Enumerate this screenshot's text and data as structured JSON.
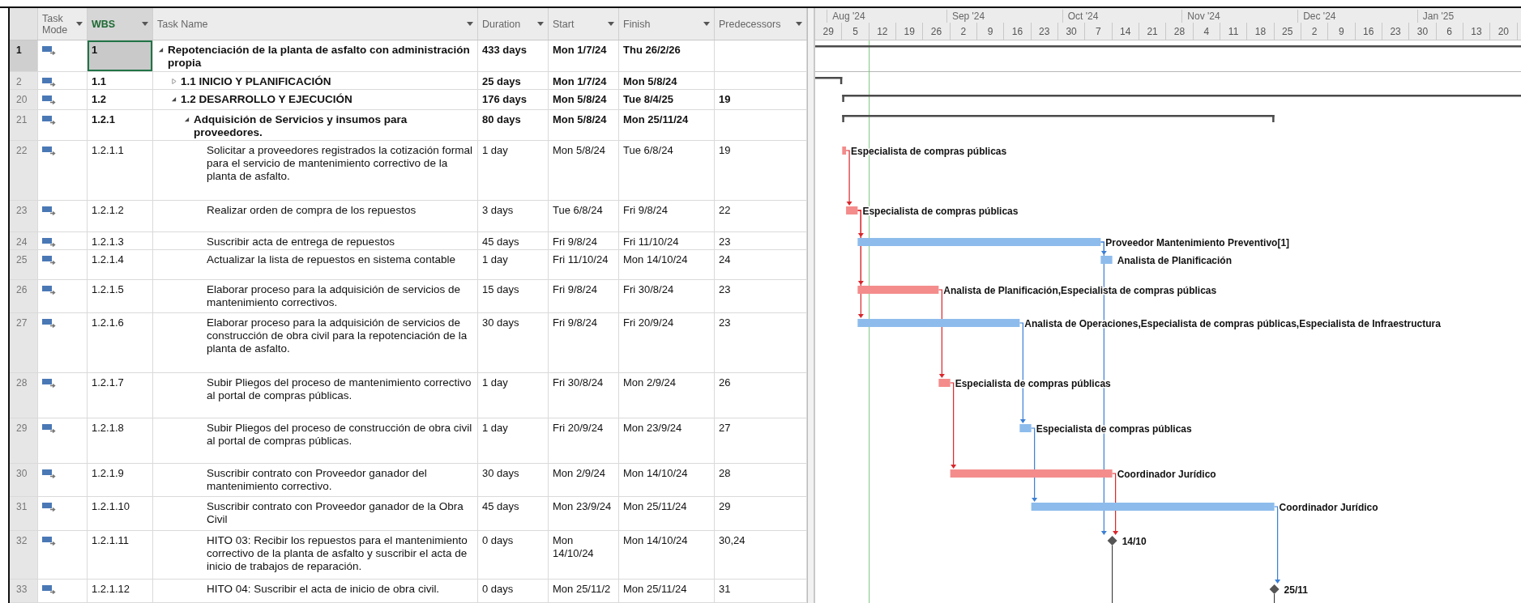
{
  "columns": [
    {
      "label": "Task Mode",
      "selected": false
    },
    {
      "label": "WBS",
      "selected": true
    },
    {
      "label": "Task Name",
      "selected": false
    },
    {
      "label": "Duration",
      "selected": false
    },
    {
      "label": "Start",
      "selected": false
    },
    {
      "label": "Finish",
      "selected": false
    },
    {
      "label": "Predecessors",
      "selected": false
    }
  ],
  "timescale": {
    "months": [
      "Aug '24",
      "Sep '24",
      "Oct '24",
      "Nov '24",
      "Dec '24",
      "Jan '25"
    ],
    "weeks": [
      "29",
      "5",
      "12",
      "19",
      "26",
      "2",
      "9",
      "16",
      "23",
      "30",
      "7",
      "14",
      "21",
      "28",
      "4",
      "11",
      "18",
      "25",
      "2",
      "9",
      "16",
      "23",
      "30",
      "6",
      "13",
      "20"
    ]
  },
  "tasks": [
    {
      "id": "1",
      "kind": "summary",
      "selected": true,
      "expanded": true,
      "wbs": "1",
      "name": "Repotenciación de la planta de asfalto con administración propia",
      "duration": "433 days",
      "start": "Mon 1/7/24",
      "finish": "Thu 26/2/26",
      "children": [
        {
          "id": "2",
          "kind": "summary",
          "selected": false,
          "expanded": false,
          "wbs": "1.1",
          "name": "1.1 INICIO Y PLANIFICACIÓN",
          "duration": "25 days",
          "start": "Mon 1/7/24",
          "finish": "Mon 5/8/24"
        },
        {
          "id": "20",
          "kind": "summary",
          "selected": false,
          "expanded": true,
          "wbs": "1.2",
          "name": "1.2 DESARROLLO Y EJECUCIÓN",
          "duration": "176 days",
          "start": "Mon 5/8/24",
          "finish": "Tue 8/4/25",
          "predecessors": "19",
          "children": [
            {
              "id": "21",
              "kind": "summary",
              "selected": false,
              "expanded": true,
              "wbs": "1.2.1",
              "name": "Adquisición de Servicios y insumos para proveedores.",
              "duration": "80 days",
              "start": "Mon 5/8/24",
              "finish": "Mon 25/11/24",
              "children": [
                {
                  "id": "22",
                  "kind": "task",
                  "selected": false,
                  "critical": true,
                  "wbs": "1.2.1.1",
                  "name": "Solicitar a proveedores registrados la cotización formal para el servicio de mantenimiento correctivo de la planta de asfalto.",
                  "duration": "1 day",
                  "start": "Mon 5/8/24",
                  "finish": "Tue 6/8/24",
                  "predecessors": "19",
                  "resources": "Especialista de compras públicas"
                },
                {
                  "id": "23",
                  "kind": "task",
                  "selected": false,
                  "critical": true,
                  "wbs": "1.2.1.2",
                  "name": "Realizar orden de compra de los repuestos",
                  "duration": "3 days",
                  "start": "Tue 6/8/24",
                  "finish": "Fri 9/8/24",
                  "predecessors": "22",
                  "resources": "Especialista de compras públicas"
                },
                {
                  "id": "24",
                  "kind": "task",
                  "selected": false,
                  "critical": false,
                  "wbs": "1.2.1.3",
                  "name": "Suscribir acta de entrega de repuestos",
                  "duration": "45 days",
                  "start": "Fri 9/8/24",
                  "finish": "Fri 11/10/24",
                  "predecessors": "23",
                  "resources": "Proveedor Mantenimiento Preventivo[1]"
                },
                {
                  "id": "25",
                  "kind": "task",
                  "selected": false,
                  "critical": false,
                  "wbs": "1.2.1.4",
                  "name": "Actualizar la lista de repuestos en sistema contable",
                  "duration": "1 day",
                  "start": "Fri 11/10/24",
                  "finish": "Mon 14/10/24",
                  "predecessors": "24",
                  "resources": "Analista de Planificación"
                },
                {
                  "id": "26",
                  "kind": "task",
                  "selected": false,
                  "critical": true,
                  "wbs": "1.2.1.5",
                  "name": "Elaborar proceso para la adquisición de servicios de mantenimiento correctivos.",
                  "duration": "15 days",
                  "start": "Fri 9/8/24",
                  "finish": "Fri 30/8/24",
                  "predecessors": "23",
                  "resources": "Analista de Planificación,Especialista de compras públicas"
                },
                {
                  "id": "27",
                  "kind": "task",
                  "selected": false,
                  "critical": false,
                  "wbs": "1.2.1.6",
                  "name": "Elaborar proceso para la adquisición de servicios de construcción de obra civil para la repotenciación de la planta de asfalto.",
                  "duration": "30 days",
                  "start": "Fri 9/8/24",
                  "finish": "Fri 20/9/24",
                  "predecessors": "23",
                  "resources": "Analista de Operaciones,Especialista de compras públicas,Especialista de Infraestructura"
                },
                {
                  "id": "28",
                  "kind": "task",
                  "selected": false,
                  "critical": true,
                  "wbs": "1.2.1.7",
                  "name": "Subir Pliegos del proceso de mantenimiento correctivo al portal de compras públicas.",
                  "duration": "1 day",
                  "start": "Fri 30/8/24",
                  "finish": "Mon 2/9/24",
                  "predecessors": "26",
                  "resources": "Especialista de compras públicas"
                },
                {
                  "id": "29",
                  "kind": "task",
                  "selected": false,
                  "critical": false,
                  "wbs": "1.2.1.8",
                  "name": "Subir Pliegos del proceso de construcción de obra civil al portal de compras públicas.",
                  "duration": "1 day",
                  "start": "Fri 20/9/24",
                  "finish": "Mon 23/9/24",
                  "predecessors": "27",
                  "resources": "Especialista de compras públicas"
                },
                {
                  "id": "30",
                  "kind": "task",
                  "selected": false,
                  "critical": true,
                  "wbs": "1.2.1.9",
                  "name": "Suscribir contrato con Proveedor ganador del mantenimiento correctivo.",
                  "duration": "30 days",
                  "start": "Mon 2/9/24",
                  "finish": "Mon 14/10/24",
                  "predecessors": "28",
                  "resources": "Coordinador Jurídico"
                },
                {
                  "id": "31",
                  "kind": "task",
                  "selected": false,
                  "critical": false,
                  "wbs": "1.2.1.10",
                  "name": "Suscribir contrato con Proveedor ganador de la Obra Civil",
                  "duration": "45 days",
                  "start": "Mon 23/9/24",
                  "finish": "Mon 25/11/24",
                  "predecessors": "29",
                  "resources": "Coordinador Jurídico"
                },
                {
                  "id": "32",
                  "kind": "milestone",
                  "selected": false,
                  "wbs": "1.2.1.11",
                  "name": "HITO 03: Recibir los repuestos para el mantenimiento correctivo de la planta de asfalto y suscribir el acta de inicio de trabajos de reparación.",
                  "duration": "0 days",
                  "start": "Mon 14/10/24",
                  "finish": "Mon 14/10/24",
                  "predecessors": "30,24",
                  "date_label": "14/10"
                },
                {
                  "id": "33",
                  "kind": "milestone",
                  "selected": false,
                  "wbs": "1.2.1.12",
                  "name": "HITO 04: Suscribir el acta de inicio de obra civil.",
                  "duration": "0 days",
                  "start": "Mon 25/11/2",
                  "finish": "Mon 25/11/24",
                  "predecessors": "31",
                  "date_label": "25/11"
                }
              ]
            }
          ]
        }
      ]
    }
  ]
}
